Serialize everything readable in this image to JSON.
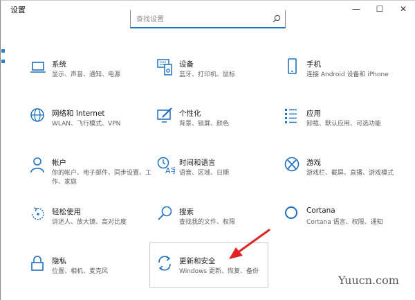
{
  "window": {
    "title": "设置"
  },
  "controls": {
    "minimize": "—",
    "maximize": "☐",
    "close": "✕"
  },
  "search": {
    "placeholder": "查找设置"
  },
  "tiles": [
    {
      "name": "系统",
      "desc": "显示、声音、通知、电源",
      "icon": "laptop-icon"
    },
    {
      "name": "设备",
      "desc": "蓝牙、打印机、鼠标",
      "icon": "keyboard-device-icon"
    },
    {
      "name": "手机",
      "desc": "连接 Android 设备和 iPhone",
      "icon": "phone-icon"
    },
    {
      "name": "网络和 Internet",
      "desc": "WLAN、飞行模式、VPN",
      "icon": "globe-icon"
    },
    {
      "name": "个性化",
      "desc": "背景、锁屏、颜色",
      "icon": "paint-brush-icon"
    },
    {
      "name": "应用",
      "desc": "卸载、默认应用、可选功能",
      "icon": "apps-list-icon"
    },
    {
      "name": "帐户",
      "desc": "你的帐户、电子邮件、同步设置、工作、家庭",
      "icon": "person-icon"
    },
    {
      "name": "时间和语言",
      "desc": "语音、区域、日期",
      "icon": "time-language-icon"
    },
    {
      "name": "游戏",
      "desc": "游戏栏、截屏、直播、游戏模式",
      "icon": "xbox-icon"
    },
    {
      "name": "轻松使用",
      "desc": "讲述人、放大镜、高对比度",
      "icon": "ease-of-access-icon"
    },
    {
      "name": "搜索",
      "desc": "查找我的文件、权限",
      "icon": "magnifier-icon"
    },
    {
      "name": "Cortana",
      "desc": "Cortana 语言、权限、通知",
      "icon": "cortana-ring-icon"
    },
    {
      "name": "隐私",
      "desc": "位置、相机、麦克风",
      "icon": "lock-icon"
    },
    {
      "name": "更新和安全",
      "desc": "Windows 更新、恢复、备份",
      "icon": "sync-icon"
    }
  ],
  "watermark": "Yuucn.com",
  "colors": {
    "accent": "#1f6fbf",
    "arrow": "#e02424"
  }
}
